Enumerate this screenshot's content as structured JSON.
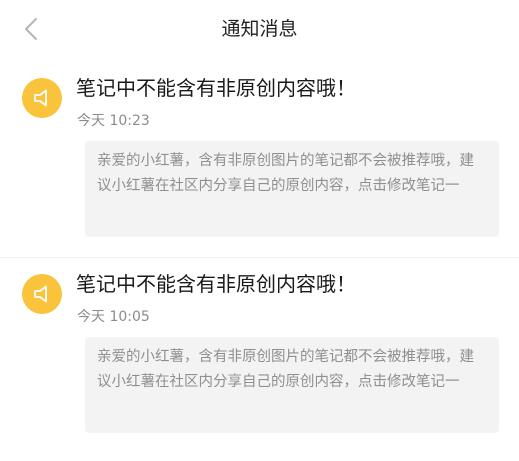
{
  "header": {
    "title": "通知消息",
    "back_icon": "chevron-left-icon"
  },
  "notices": [
    {
      "icon": "speaker-icon",
      "icon_color": "#f9c33c",
      "title": "笔记中不能含有非原创内容哦！",
      "time": "今天 10:23",
      "body": "亲爱的小红薯，含有非原创图片的笔记都不会被推荐哦，建议小红薯在社区内分享自己的原创内容，点击修改笔记一"
    },
    {
      "icon": "speaker-icon",
      "icon_color": "#f9c33c",
      "title": "笔记中不能含有非原创内容哦！",
      "time": "今天 10:05",
      "body": "亲爱的小红薯，含有非原创图片的笔记都不会被推荐哦，建议小红薯在社区内分享自己的原创内容，点击修改笔记一"
    }
  ]
}
